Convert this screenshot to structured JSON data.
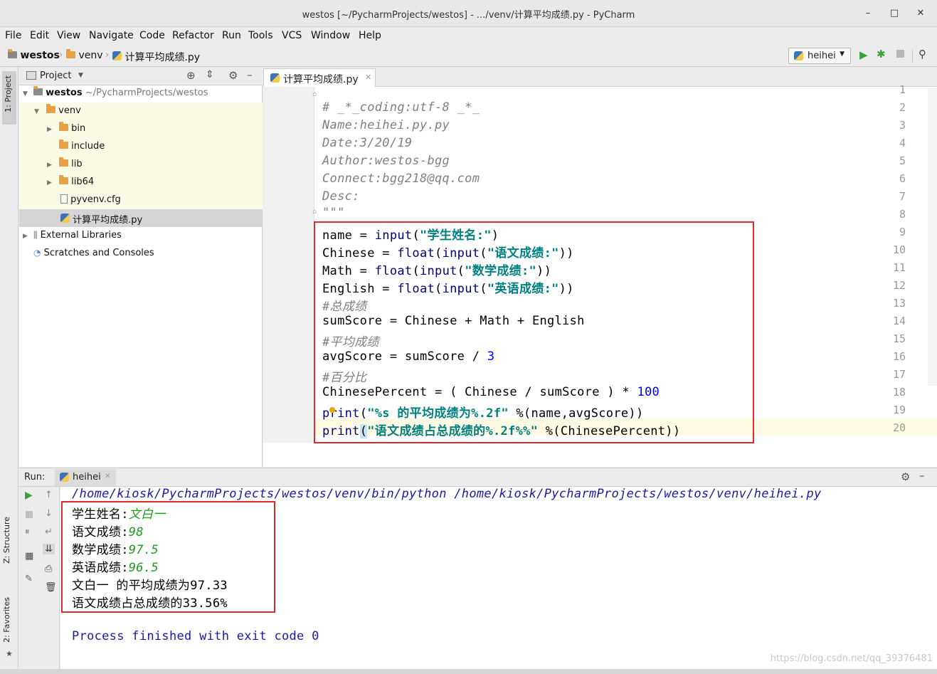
{
  "window": {
    "title": "westos [~/PycharmProjects/westos] - .../venv/计算平均成绩.py - PyCharm",
    "min": "–",
    "max": "□",
    "close": "✕"
  },
  "menu": [
    "File",
    "Edit",
    "View",
    "Navigate",
    "Code",
    "Refactor",
    "Run",
    "Tools",
    "VCS",
    "Window",
    "Help"
  ],
  "breadcrumb": [
    "westos",
    "venv",
    "计算平均成绩.py"
  ],
  "run_config": "heihei",
  "toolwindows": {
    "project": "1: Project",
    "structure": "Z: Structure",
    "favorites": "2: Favorites"
  },
  "project": {
    "header": "Project",
    "root_name": "westos",
    "root_path": "~/PycharmProjects/westos",
    "items": [
      "venv",
      "bin",
      "include",
      "lib",
      "lib64",
      "pyvenv.cfg",
      "计算平均成绩.py",
      "External Libraries",
      "Scratches and Consoles"
    ]
  },
  "editor": {
    "tab": "计算平均成绩.py",
    "line_numbers": [
      "1",
      "2",
      "3",
      "4",
      "5",
      "6",
      "7",
      "8",
      "9",
      "10",
      "11",
      "12",
      "13",
      "14",
      "15",
      "16",
      "17",
      "18",
      "19",
      "20"
    ],
    "comments": [
      "# _*_coding:utf-8 _*_",
      "Name:heihei.py.py",
      "Date:3/20/19",
      "Author:westos-bgg",
      "Connect:bgg218@qq.com",
      "Desc:",
      "\"\"\""
    ],
    "code": {
      "l9a": "name = ",
      "l9b": "input",
      "l9c": "(",
      "l9d": "\"学生姓名:\"",
      "l9e": ")",
      "l10a": "Chinese = ",
      "l10b": "float",
      "l10c": "(",
      "l10d": "input",
      "l10e": "(",
      "l10f": "\"语文成绩:\"",
      "l10g": "))",
      "l11a": "Math = ",
      "l11b": "float",
      "l11c": "(",
      "l11d": "input",
      "l11e": "(",
      "l11f": "\"数学成绩:\"",
      "l11g": "))",
      "l12a": "English = ",
      "l12b": "float",
      "l12c": "(",
      "l12d": "input",
      "l12e": "(",
      "l12f": "\"英语成绩:\"",
      "l12g": "))",
      "l13": "#总成绩",
      "l14": "sumScore = Chinese + Math + English",
      "l15": "#平均成绩",
      "l16a": "avgScore = sumScore / ",
      "l16b": "3",
      "l17": "#百分比",
      "l18a": "ChinesePercent = ( Chinese / sumScore ) * ",
      "l18b": "100",
      "l19a": "print",
      "l19b": "(",
      "l19c": "\"%s 的平均成绩为%.2f\"",
      "l19d": " %(name,avgScore))",
      "l20a": "print",
      "l20b": "(",
      "l20c": "\"语文成绩占总成绩的%.2f%%\"",
      "l20d": " %(ChinesePercent))"
    }
  },
  "run": {
    "label": "Run:",
    "tab": "heihei",
    "command": "/home/kiosk/PycharmProjects/westos/venv/bin/python /home/kiosk/PycharmProjects/westos/venv/heihei.py",
    "output": [
      {
        "prompt": "学生姓名:",
        "input": "文白一"
      },
      {
        "prompt": "语文成绩:",
        "input": "98"
      },
      {
        "prompt": "数学成绩:",
        "input": "97.5"
      },
      {
        "prompt": "英语成绩:",
        "input": "96.5"
      },
      {
        "prompt": "文白一 的平均成绩为97.33",
        "input": ""
      },
      {
        "prompt": "语文成绩占总成绩的33.56%",
        "input": ""
      }
    ],
    "finished": "Process finished with exit code 0"
  },
  "watermark": "https://blog.csdn.net/qq_39376481"
}
